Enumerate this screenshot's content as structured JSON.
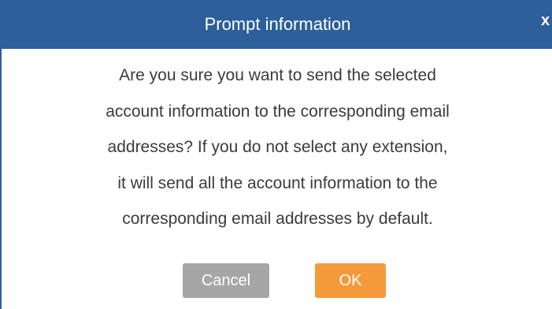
{
  "dialog": {
    "title": "Prompt information",
    "close_label": "x",
    "message_lines": [
      "Are you sure you want to send the selected",
      "account information to the corresponding email",
      "addresses? If you do not select any extension,",
      "it will send all the account information to the",
      "corresponding email addresses by default."
    ],
    "cancel_label": "Cancel",
    "ok_label": "OK"
  },
  "colors": {
    "title_bar": "#2d5f9a",
    "cancel_button": "#a6a6a6",
    "ok_button": "#f49a3a",
    "message_text": "#3b3b3b"
  },
  "icons": {
    "close": "close-icon"
  }
}
